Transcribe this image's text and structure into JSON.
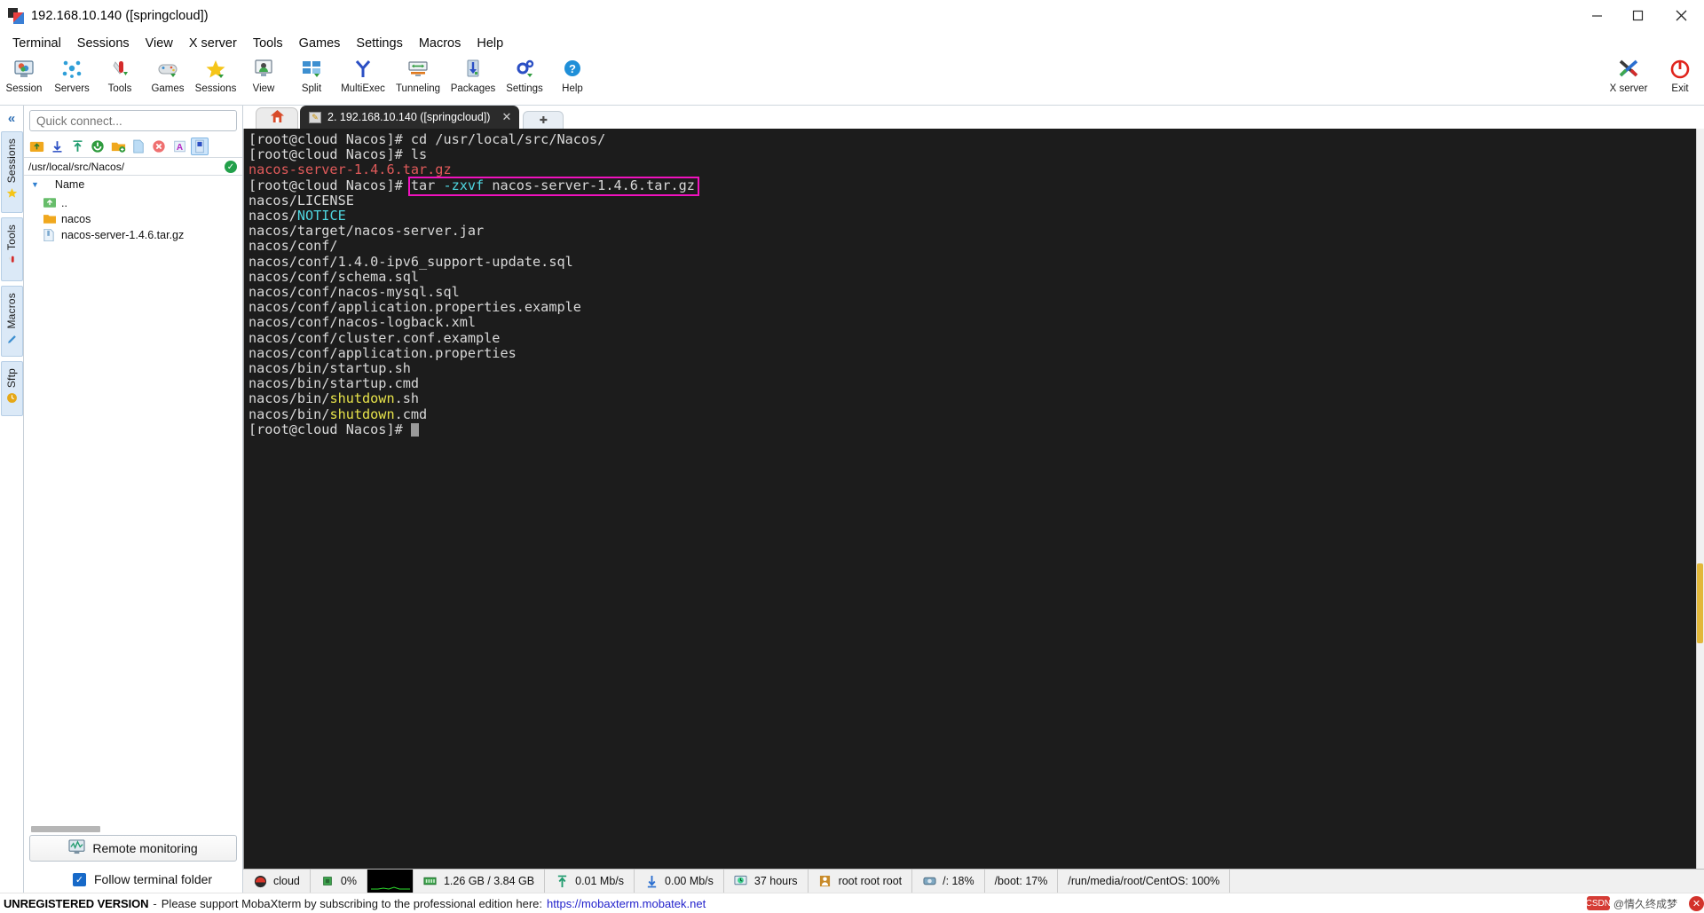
{
  "window": {
    "title": "192.168.10.140 ([springcloud])",
    "app_icon": "mobaxterm-icon",
    "controls": {
      "minimize": "minimize-icon",
      "maximize": "maximize-icon",
      "close": "close-icon"
    }
  },
  "menu": {
    "items": [
      "Terminal",
      "Sessions",
      "View",
      "X server",
      "Tools",
      "Games",
      "Settings",
      "Macros",
      "Help"
    ]
  },
  "toolbar": {
    "items": [
      {
        "label": "Session",
        "icon": "session-icon"
      },
      {
        "label": "Servers",
        "icon": "servers-icon"
      },
      {
        "label": "Tools",
        "icon": "tools-icon"
      },
      {
        "label": "Games",
        "icon": "games-icon"
      },
      {
        "label": "Sessions",
        "icon": "sessions-star-icon"
      },
      {
        "label": "View",
        "icon": "view-icon"
      },
      {
        "label": "Split",
        "icon": "split-icon"
      },
      {
        "label": "MultiExec",
        "icon": "multiexec-icon"
      },
      {
        "label": "Tunneling",
        "icon": "tunneling-icon"
      },
      {
        "label": "Packages",
        "icon": "packages-icon"
      },
      {
        "label": "Settings",
        "icon": "settings-gear-icon"
      },
      {
        "label": "Help",
        "icon": "help-icon"
      }
    ],
    "right_items": [
      {
        "label": "X server",
        "icon": "x-server-icon"
      },
      {
        "label": "Exit",
        "icon": "power-exit-icon"
      }
    ]
  },
  "rail": {
    "collapse_icon": "double-chevron-left-icon",
    "tabs": [
      {
        "label": "Sessions",
        "icon": "star-icon"
      },
      {
        "label": "Tools",
        "icon": "swiss-knife-icon"
      },
      {
        "label": "Macros",
        "icon": "macro-pen-icon"
      },
      {
        "label": "Sftp",
        "icon": "sftp-clock-icon"
      }
    ]
  },
  "file_browser": {
    "quick_connect_placeholder": "Quick connect...",
    "tool_icons": [
      "upload-folder-icon",
      "download-icon",
      "upload-icon",
      "refresh-icon",
      "new-folder-icon",
      "new-file-icon",
      "delete-icon",
      "rename-icon",
      "terminal-view-icon"
    ],
    "path": "/usr/local/src/Nacos/",
    "path_status_icon": "check-circle-icon",
    "column_header": "Name",
    "sort_caret_icon": "caret-down-icon",
    "rows": [
      {
        "name": "..",
        "icon": "parent-folder-icon"
      },
      {
        "name": "nacos",
        "icon": "folder-icon"
      },
      {
        "name": "nacos-server-1.4.6.tar.gz",
        "icon": "archive-file-icon"
      }
    ],
    "remote_monitoring_label": "Remote monitoring",
    "remote_monitoring_icon": "monitor-graph-icon",
    "follow_terminal_folder_label": "Follow terminal folder",
    "follow_terminal_folder_checked": true
  },
  "tabs": {
    "home_icon": "home-icon",
    "active": {
      "title": "2. 192.168.10.140 ([springcloud])",
      "icon": "ssh-session-icon",
      "close_icon": "close-icon"
    },
    "new_tab_icon": "plus-icon"
  },
  "terminal": {
    "prompt": "[root@cloud Nacos]#",
    "highlight_color": "#f012be",
    "lines": [
      {
        "segments": [
          {
            "t": "[root@cloud Nacos]# cd /usr/local/src/Nacos/",
            "c": "g"
          }
        ]
      },
      {
        "segments": [
          {
            "t": "[root@cloud Nacos]# ls",
            "c": "g"
          }
        ]
      },
      {
        "segments": [
          {
            "t": "nacos-server-1.4.6.tar.gz",
            "c": "red"
          }
        ]
      },
      {
        "segments": [
          {
            "t": "[root@cloud Nacos]# ",
            "c": "g"
          },
          {
            "t": "tar ",
            "c": "g"
          },
          {
            "t": "-zxvf",
            "c": "cy"
          },
          {
            "t": " nacos-server-1.4.6.tar.gz",
            "c": "g"
          }
        ]
      },
      {
        "segments": [
          {
            "t": "nacos/LICENSE",
            "c": "g"
          }
        ]
      },
      {
        "segments": [
          {
            "t": "nacos/",
            "c": "g"
          },
          {
            "t": "NOTICE",
            "c": "cy"
          }
        ]
      },
      {
        "segments": [
          {
            "t": "nacos/target/nacos-server.jar",
            "c": "g"
          }
        ]
      },
      {
        "segments": [
          {
            "t": "nacos/conf/",
            "c": "g"
          }
        ]
      },
      {
        "segments": [
          {
            "t": "nacos/conf/1.4.0-ipv6_support-update.sql",
            "c": "g"
          }
        ]
      },
      {
        "segments": [
          {
            "t": "nacos/conf/schema.sql",
            "c": "g"
          }
        ]
      },
      {
        "segments": [
          {
            "t": "nacos/conf/nacos-mysql.sql",
            "c": "g"
          }
        ]
      },
      {
        "segments": [
          {
            "t": "nacos/conf/application.properties.example",
            "c": "g"
          }
        ]
      },
      {
        "segments": [
          {
            "t": "nacos/conf/nacos-logback.xml",
            "c": "g"
          }
        ]
      },
      {
        "segments": [
          {
            "t": "nacos/conf/cluster.conf.example",
            "c": "g"
          }
        ]
      },
      {
        "segments": [
          {
            "t": "nacos/conf/application.properties",
            "c": "g"
          }
        ]
      },
      {
        "segments": [
          {
            "t": "nacos/bin/startup.sh",
            "c": "g"
          }
        ]
      },
      {
        "segments": [
          {
            "t": "nacos/bin/startup.cmd",
            "c": "g"
          }
        ]
      },
      {
        "segments": [
          {
            "t": "nacos/bin/",
            "c": "g"
          },
          {
            "t": "shutdown",
            "c": "ye"
          },
          {
            "t": ".sh",
            "c": "g"
          }
        ]
      },
      {
        "segments": [
          {
            "t": "nacos/bin/",
            "c": "g"
          },
          {
            "t": "shutdown",
            "c": "ye"
          },
          {
            "t": ".cmd",
            "c": "g"
          }
        ]
      },
      {
        "segments": [
          {
            "t": "[root@cloud Nacos]# ",
            "c": "g"
          },
          {
            "t": "CURSOR",
            "c": "cursor"
          }
        ]
      }
    ]
  },
  "status_bar": {
    "cells": [
      {
        "icon": "centos-logo-icon",
        "label": "cloud"
      },
      {
        "icon": "cpu-icon",
        "label": "0%"
      },
      {
        "icon": "cpu-graph-icon",
        "label": ""
      },
      {
        "icon": "memory-icon",
        "label": "1.26 GB / 3.84 GB"
      },
      {
        "icon": "upload-arrow-icon",
        "label": "0.01 Mb/s"
      },
      {
        "icon": "download-arrow-icon",
        "label": "0.00 Mb/s"
      },
      {
        "icon": "uptime-clock-icon",
        "label": "37 hours"
      },
      {
        "icon": "user-icon",
        "label": "root  root  root"
      },
      {
        "icon": "disk-icon",
        "label": "/: 18%"
      },
      {
        "icon": "",
        "label": "/boot: 17%"
      },
      {
        "icon": "",
        "label": "/run/media/root/CentOS: 100%"
      }
    ]
  },
  "ad_bar": {
    "unregistered": "UNREGISTERED VERSION",
    "dash": "-",
    "message": "Please support MobaXterm by subscribing to the professional edition here:",
    "link": "https://mobaxterm.mobatek.net",
    "watermark_badge": "CSDN",
    "watermark_text": "@情久终成梦",
    "close_icon": "close-icon"
  }
}
